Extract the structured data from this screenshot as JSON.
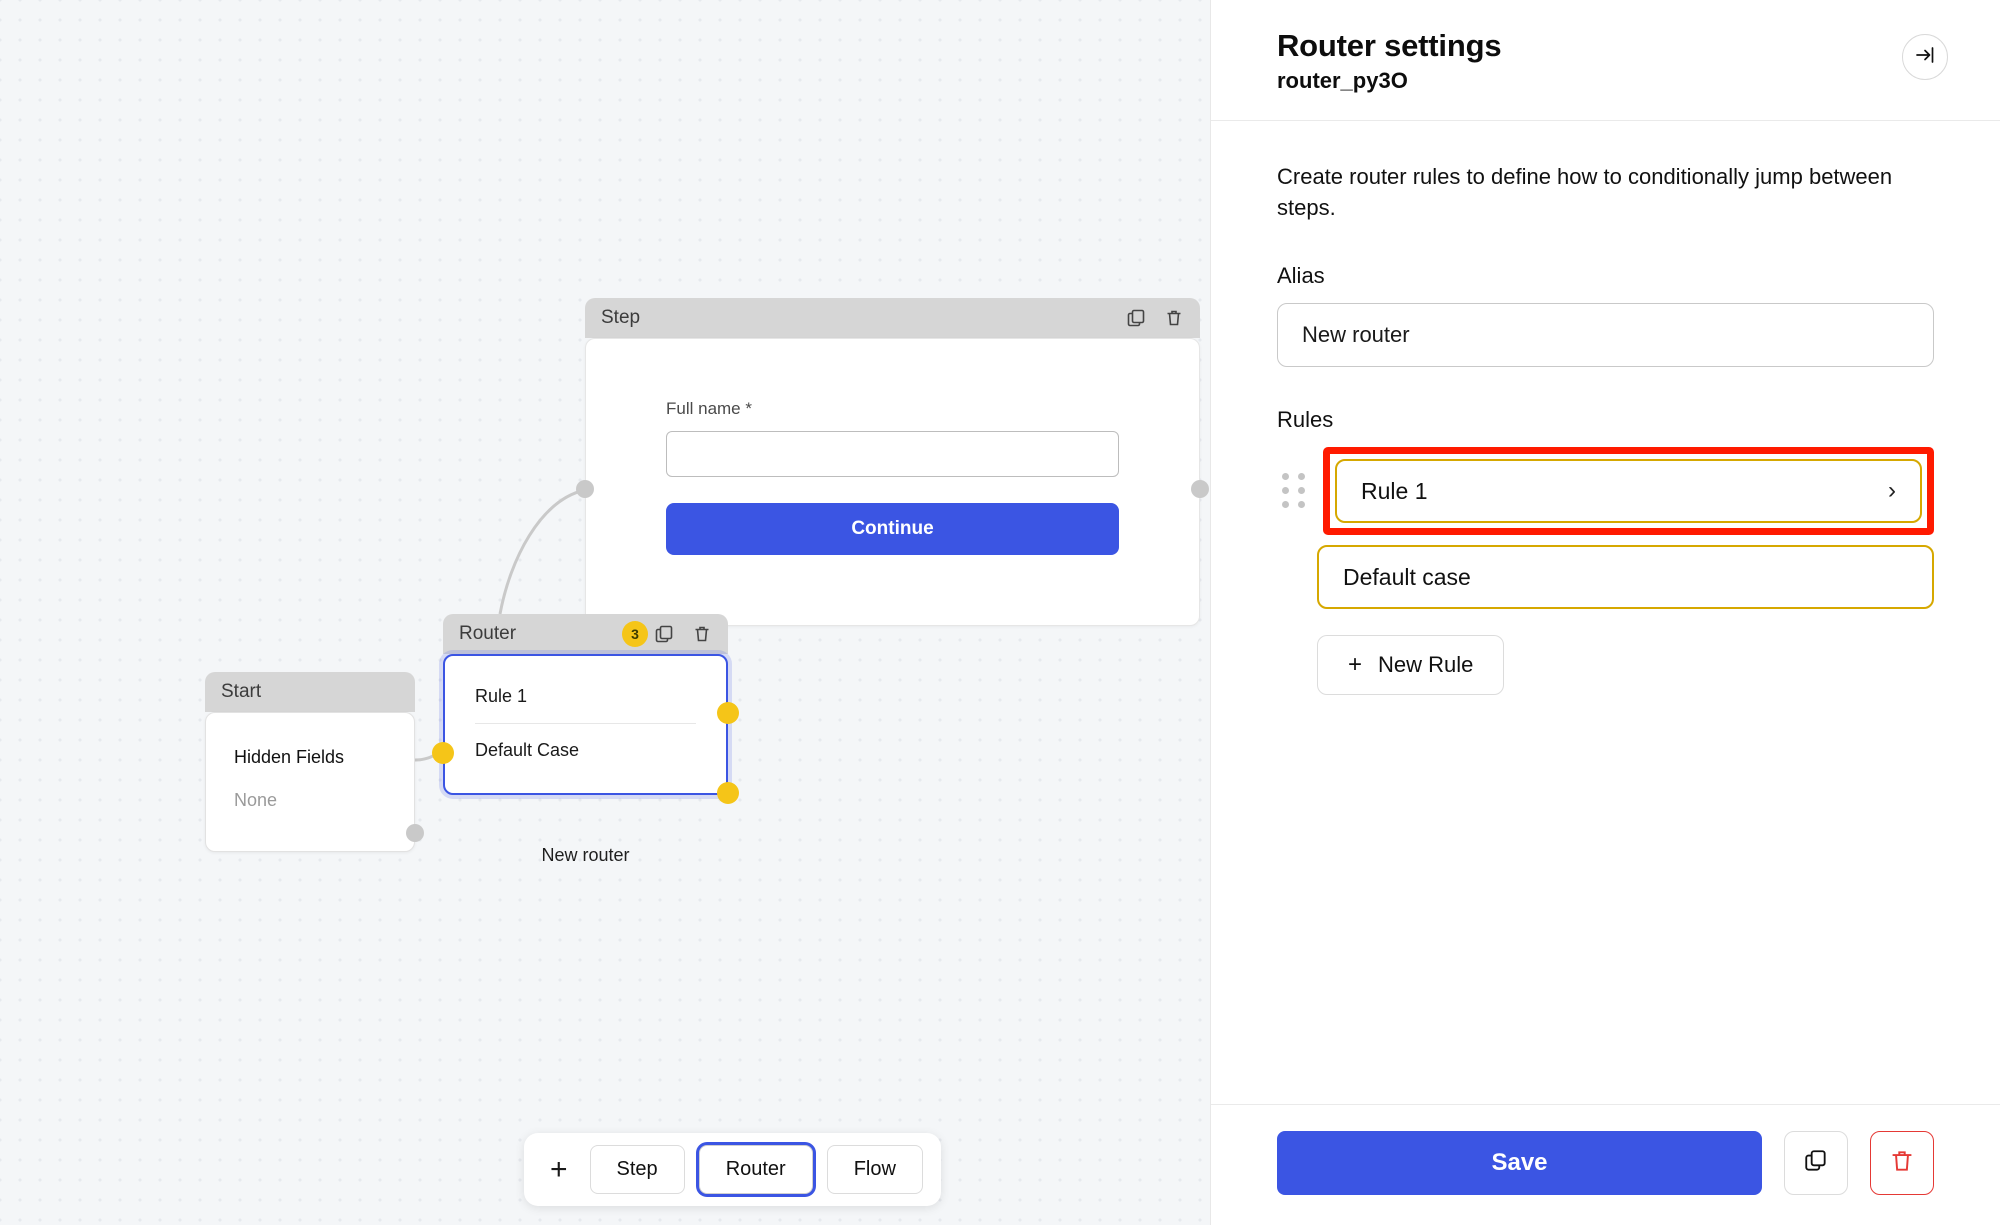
{
  "canvas": {
    "start_node": {
      "header_title": "Start",
      "hidden_fields_title": "Hidden Fields",
      "hidden_fields_value": "None"
    },
    "step_node": {
      "header_title": "Step",
      "field_label": "Full name *",
      "field_value": "",
      "continue_label": "Continue",
      "copy_icon": "copy-icon",
      "delete_icon": "trash-icon"
    },
    "router_node": {
      "header_title": "Router",
      "badge_count": "3",
      "rule_1": "Rule 1",
      "default_case": "Default Case",
      "caption": "New router",
      "copy_icon": "copy-icon",
      "delete_icon": "trash-icon"
    },
    "toolbar": {
      "plus": "+",
      "buttons": [
        {
          "label": "Step",
          "selected": false
        },
        {
          "label": "Router",
          "selected": true
        },
        {
          "label": "Flow",
          "selected": false
        }
      ]
    }
  },
  "panel": {
    "title": "Router settings",
    "subtitle": "router_py3O",
    "collapse_icon": "collapse-right-icon",
    "description": "Create router rules to define how to conditionally jump between steps.",
    "alias_label": "Alias",
    "alias_value": "New router",
    "alias_placeholder": "Alias",
    "rules_label": "Rules",
    "rules": [
      {
        "label": "Rule 1",
        "chevron": "›",
        "highlighted": true
      },
      {
        "label": "Default case",
        "chevron": "",
        "highlighted": false
      }
    ],
    "new_rule_label": "New Rule",
    "new_rule_plus": "+",
    "footer": {
      "save_label": "Save",
      "duplicate_icon": "copy-icon",
      "delete_icon": "trash-icon"
    }
  },
  "colors": {
    "accent_blue": "#3b55e3",
    "rule_border_gold": "#d6a800",
    "annotation_red": "#ff1a00",
    "handle_yellow": "#f5c518",
    "danger_red": "#e53935",
    "canvas_bg": "#f4f6f8"
  }
}
